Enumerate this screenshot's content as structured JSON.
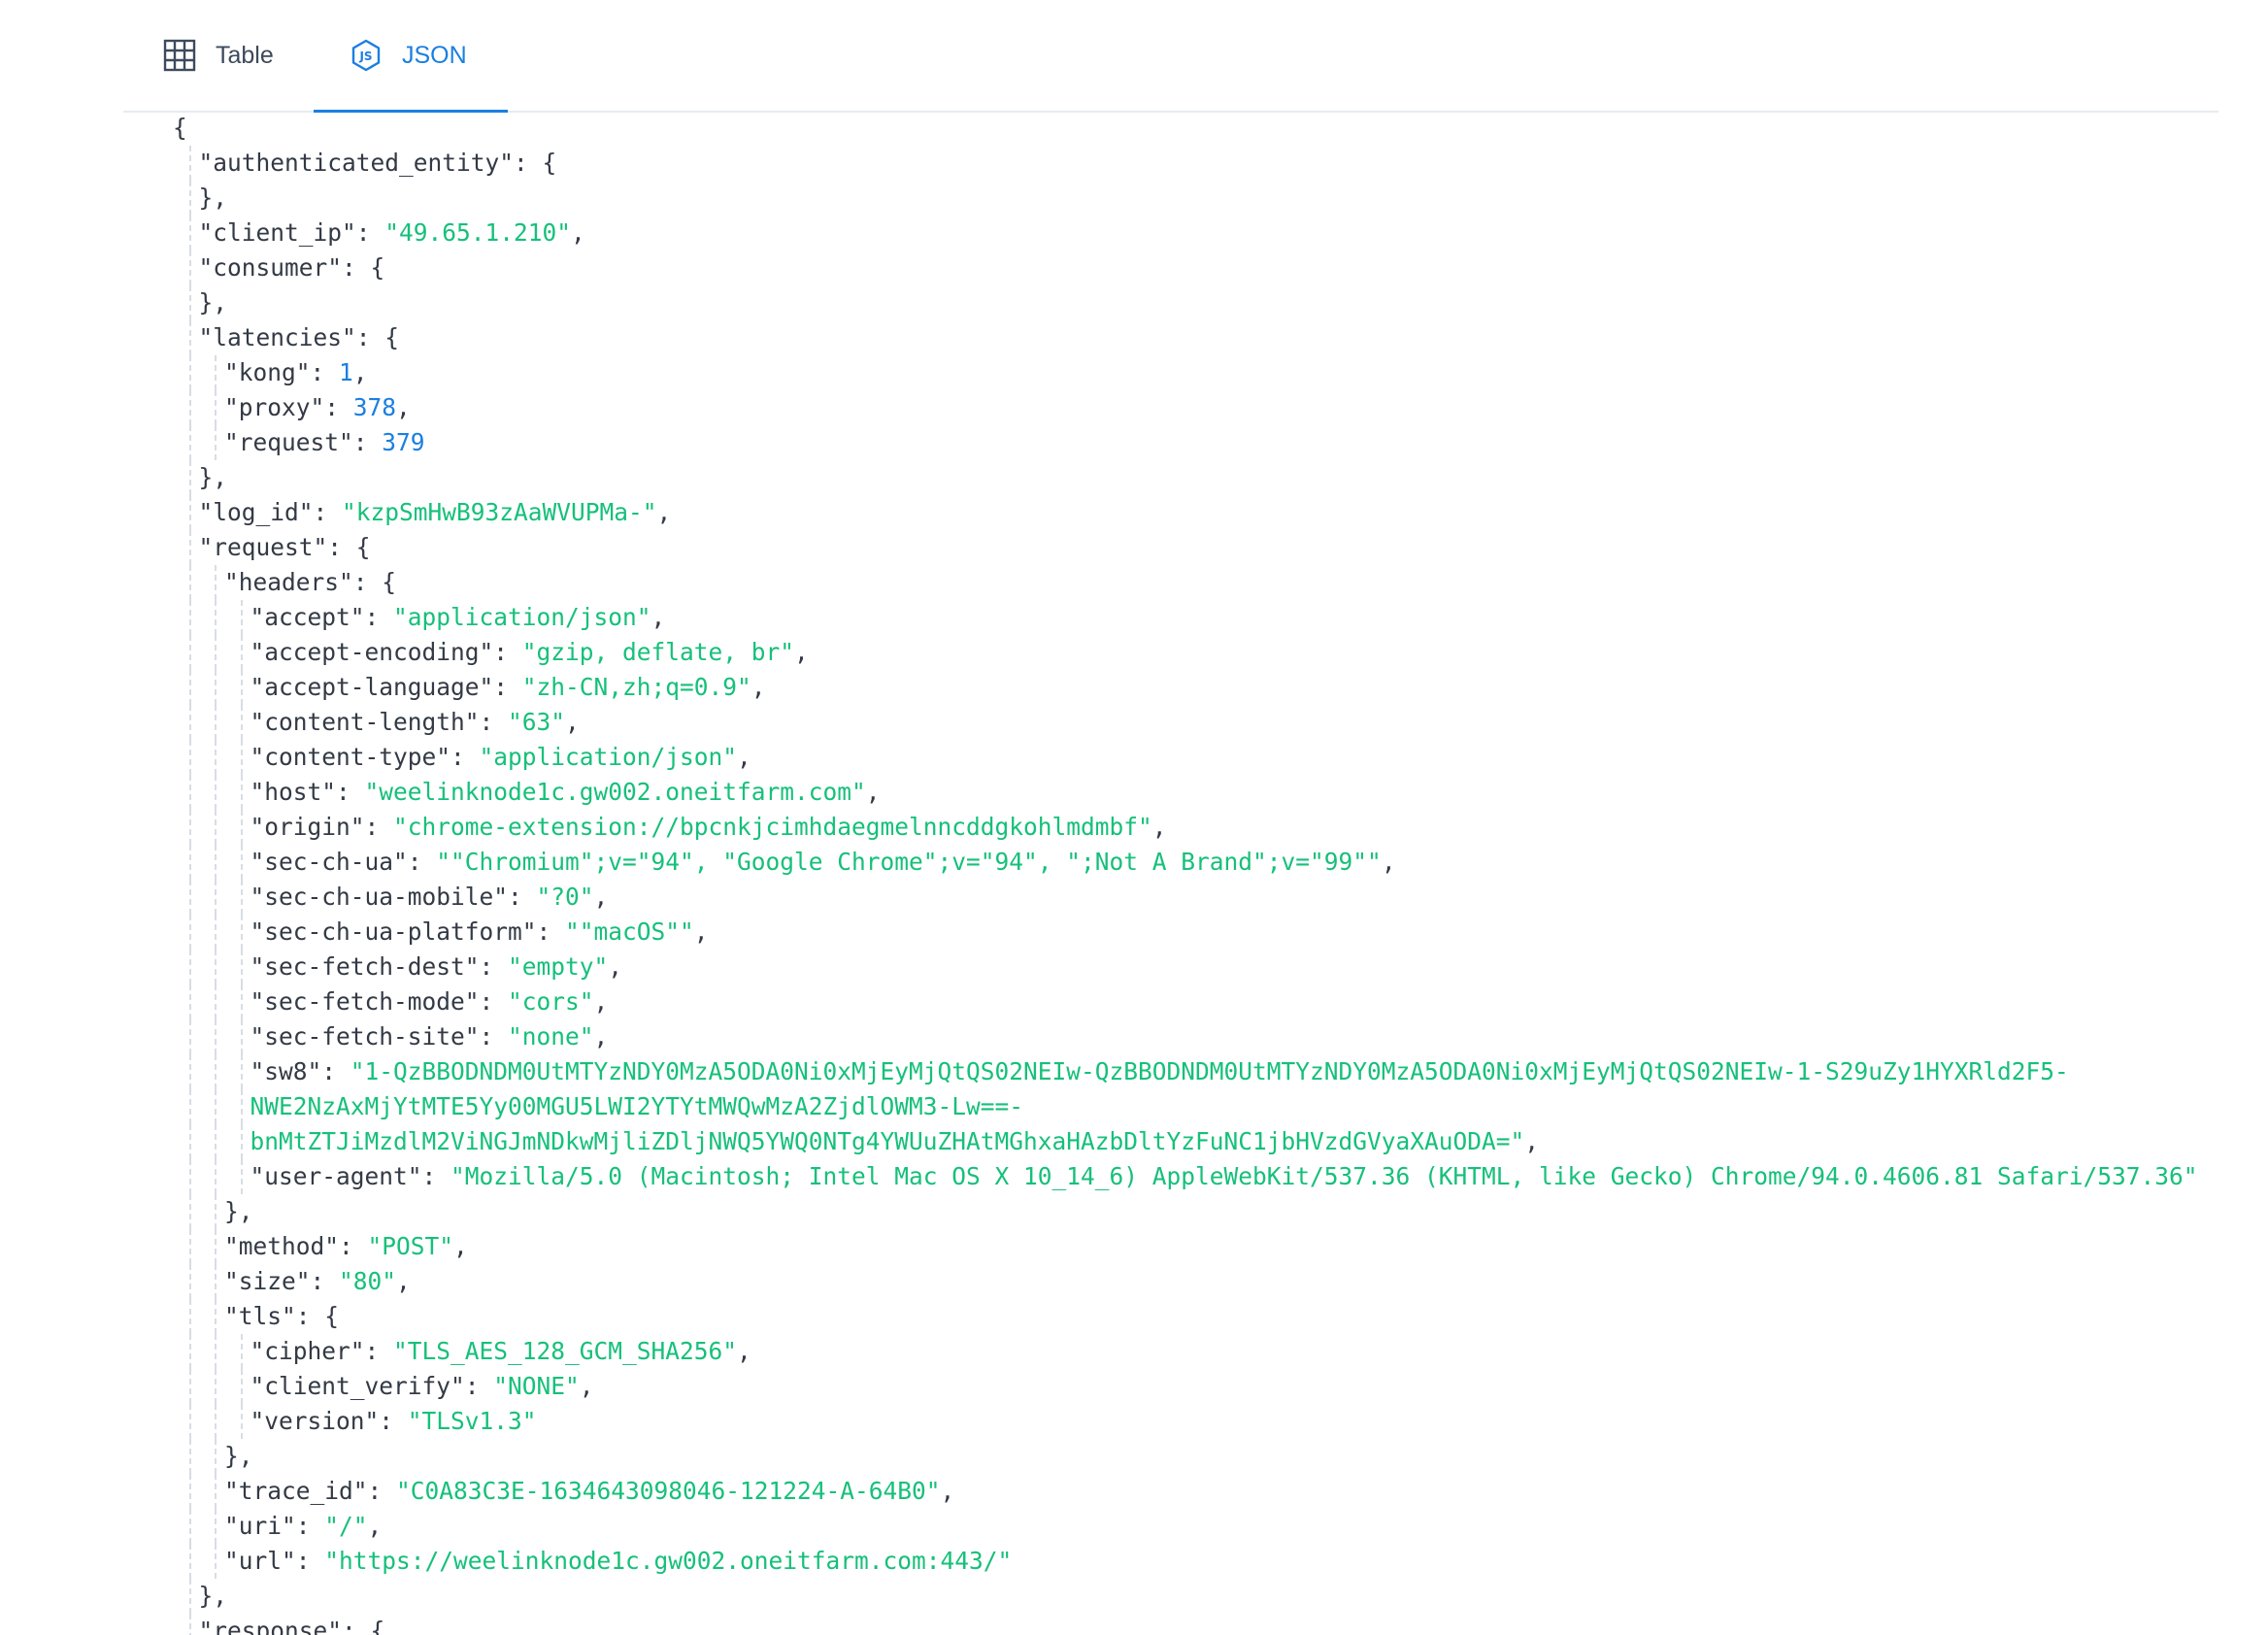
{
  "tabs": [
    {
      "label": "Table",
      "icon": "grid-table-icon",
      "active": false
    },
    {
      "label": "JSON",
      "icon": "js-hexagon-icon",
      "active": true
    }
  ],
  "colors": {
    "accent": "#1b7fe0",
    "string": "#16c07a",
    "number": "#1b7fe0",
    "key": "#333a45",
    "guide": "#d8dde3"
  },
  "json_lines": [
    {
      "depth": 0,
      "segments": [
        {
          "t": "p",
          "v": "{"
        }
      ]
    },
    {
      "depth": 1,
      "segments": [
        {
          "t": "k",
          "v": "\"authenticated_entity\""
        },
        {
          "t": "p",
          "v": ": {"
        }
      ]
    },
    {
      "depth": 1,
      "segments": [
        {
          "t": "p",
          "v": "},"
        }
      ]
    },
    {
      "depth": 1,
      "segments": [
        {
          "t": "k",
          "v": "\"client_ip\""
        },
        {
          "t": "p",
          "v": ": "
        },
        {
          "t": "s",
          "v": "\"49.65.1.210\""
        },
        {
          "t": "p",
          "v": ","
        }
      ]
    },
    {
      "depth": 1,
      "segments": [
        {
          "t": "k",
          "v": "\"consumer\""
        },
        {
          "t": "p",
          "v": ": {"
        }
      ]
    },
    {
      "depth": 1,
      "segments": [
        {
          "t": "p",
          "v": "},"
        }
      ]
    },
    {
      "depth": 1,
      "segments": [
        {
          "t": "k",
          "v": "\"latencies\""
        },
        {
          "t": "p",
          "v": ": {"
        }
      ]
    },
    {
      "depth": 2,
      "segments": [
        {
          "t": "k",
          "v": "\"kong\""
        },
        {
          "t": "p",
          "v": ": "
        },
        {
          "t": "n",
          "v": "1"
        },
        {
          "t": "p",
          "v": ","
        }
      ]
    },
    {
      "depth": 2,
      "segments": [
        {
          "t": "k",
          "v": "\"proxy\""
        },
        {
          "t": "p",
          "v": ": "
        },
        {
          "t": "n",
          "v": "378"
        },
        {
          "t": "p",
          "v": ","
        }
      ]
    },
    {
      "depth": 2,
      "segments": [
        {
          "t": "k",
          "v": "\"request\""
        },
        {
          "t": "p",
          "v": ": "
        },
        {
          "t": "n",
          "v": "379"
        }
      ]
    },
    {
      "depth": 1,
      "segments": [
        {
          "t": "p",
          "v": "},"
        }
      ]
    },
    {
      "depth": 1,
      "segments": [
        {
          "t": "k",
          "v": "\"log_id\""
        },
        {
          "t": "p",
          "v": ": "
        },
        {
          "t": "s",
          "v": "\"kzpSmHwB93zAaWVUPMa-\""
        },
        {
          "t": "p",
          "v": ","
        }
      ]
    },
    {
      "depth": 1,
      "segments": [
        {
          "t": "k",
          "v": "\"request\""
        },
        {
          "t": "p",
          "v": ": {"
        }
      ]
    },
    {
      "depth": 2,
      "segments": [
        {
          "t": "k",
          "v": "\"headers\""
        },
        {
          "t": "p",
          "v": ": {"
        }
      ]
    },
    {
      "depth": 3,
      "segments": [
        {
          "t": "k",
          "v": "\"accept\""
        },
        {
          "t": "p",
          "v": ": "
        },
        {
          "t": "s",
          "v": "\"application/json\""
        },
        {
          "t": "p",
          "v": ","
        }
      ]
    },
    {
      "depth": 3,
      "segments": [
        {
          "t": "k",
          "v": "\"accept-encoding\""
        },
        {
          "t": "p",
          "v": ": "
        },
        {
          "t": "s",
          "v": "\"gzip, deflate, br\""
        },
        {
          "t": "p",
          "v": ","
        }
      ]
    },
    {
      "depth": 3,
      "segments": [
        {
          "t": "k",
          "v": "\"accept-language\""
        },
        {
          "t": "p",
          "v": ": "
        },
        {
          "t": "s",
          "v": "\"zh-CN,zh;q=0.9\""
        },
        {
          "t": "p",
          "v": ","
        }
      ]
    },
    {
      "depth": 3,
      "segments": [
        {
          "t": "k",
          "v": "\"content-length\""
        },
        {
          "t": "p",
          "v": ": "
        },
        {
          "t": "s",
          "v": "\"63\""
        },
        {
          "t": "p",
          "v": ","
        }
      ]
    },
    {
      "depth": 3,
      "segments": [
        {
          "t": "k",
          "v": "\"content-type\""
        },
        {
          "t": "p",
          "v": ": "
        },
        {
          "t": "s",
          "v": "\"application/json\""
        },
        {
          "t": "p",
          "v": ","
        }
      ]
    },
    {
      "depth": 3,
      "segments": [
        {
          "t": "k",
          "v": "\"host\""
        },
        {
          "t": "p",
          "v": ": "
        },
        {
          "t": "s",
          "v": "\"weelinknode1c.gw002.oneitfarm.com\""
        },
        {
          "t": "p",
          "v": ","
        }
      ]
    },
    {
      "depth": 3,
      "segments": [
        {
          "t": "k",
          "v": "\"origin\""
        },
        {
          "t": "p",
          "v": ": "
        },
        {
          "t": "s",
          "v": "\"chrome-extension://bpcnkjcimhdaegmelnncddgkohlmdmbf\""
        },
        {
          "t": "p",
          "v": ","
        }
      ]
    },
    {
      "depth": 3,
      "segments": [
        {
          "t": "k",
          "v": "\"sec-ch-ua\""
        },
        {
          "t": "p",
          "v": ": "
        },
        {
          "t": "s",
          "v": "\"\"Chromium\";v=\"94\", \"Google Chrome\";v=\"94\", \";Not A Brand\";v=\"99\"\""
        },
        {
          "t": "p",
          "v": ","
        }
      ]
    },
    {
      "depth": 3,
      "segments": [
        {
          "t": "k",
          "v": "\"sec-ch-ua-mobile\""
        },
        {
          "t": "p",
          "v": ": "
        },
        {
          "t": "s",
          "v": "\"?0\""
        },
        {
          "t": "p",
          "v": ","
        }
      ]
    },
    {
      "depth": 3,
      "segments": [
        {
          "t": "k",
          "v": "\"sec-ch-ua-platform\""
        },
        {
          "t": "p",
          "v": ": "
        },
        {
          "t": "s",
          "v": "\"\"macOS\"\""
        },
        {
          "t": "p",
          "v": ","
        }
      ]
    },
    {
      "depth": 3,
      "segments": [
        {
          "t": "k",
          "v": "\"sec-fetch-dest\""
        },
        {
          "t": "p",
          "v": ": "
        },
        {
          "t": "s",
          "v": "\"empty\""
        },
        {
          "t": "p",
          "v": ","
        }
      ]
    },
    {
      "depth": 3,
      "segments": [
        {
          "t": "k",
          "v": "\"sec-fetch-mode\""
        },
        {
          "t": "p",
          "v": ": "
        },
        {
          "t": "s",
          "v": "\"cors\""
        },
        {
          "t": "p",
          "v": ","
        }
      ]
    },
    {
      "depth": 3,
      "segments": [
        {
          "t": "k",
          "v": "\"sec-fetch-site\""
        },
        {
          "t": "p",
          "v": ": "
        },
        {
          "t": "s",
          "v": "\"none\""
        },
        {
          "t": "p",
          "v": ","
        }
      ]
    },
    {
      "depth": 3,
      "segments": [
        {
          "t": "k",
          "v": "\"sw8\""
        },
        {
          "t": "p",
          "v": ": "
        },
        {
          "t": "s",
          "v": "\"1-QzBBODNDM0UtMTYzNDY0MzA5ODA0Ni0xMjEyMjQtQS02NEIw-QzBBODNDM0UtMTYzNDY0MzA5ODA0Ni0xMjEyMjQtQS02NEIw-1-S29uZy1HYXRld2F5-"
        }
      ]
    },
    {
      "depth": 3,
      "segments": [
        {
          "t": "s",
          "v": "NWE2NzAxMjYtMTE5Yy00MGU5LWI2YTYtMWQwMzA2ZjdlOWM3-Lw==-"
        }
      ]
    },
    {
      "depth": 3,
      "segments": [
        {
          "t": "s",
          "v": "bnMtZTJiMzdlM2ViNGJmNDkwMjliZDljNWQ5YWQ0NTg4YWUuZHAtMGhxaHAzbDltYzFuNC1jbHVzdGVyaXAuODA=\""
        },
        {
          "t": "p",
          "v": ","
        }
      ]
    },
    {
      "depth": 3,
      "segments": [
        {
          "t": "k",
          "v": "\"user-agent\""
        },
        {
          "t": "p",
          "v": ": "
        },
        {
          "t": "s",
          "v": "\"Mozilla/5.0 (Macintosh; Intel Mac OS X 10_14_6) AppleWebKit/537.36 (KHTML, like Gecko) Chrome/94.0.4606.81 Safari/537.36\""
        }
      ]
    },
    {
      "depth": 2,
      "segments": [
        {
          "t": "p",
          "v": "},"
        }
      ]
    },
    {
      "depth": 2,
      "segments": [
        {
          "t": "k",
          "v": "\"method\""
        },
        {
          "t": "p",
          "v": ": "
        },
        {
          "t": "s",
          "v": "\"POST\""
        },
        {
          "t": "p",
          "v": ","
        }
      ]
    },
    {
      "depth": 2,
      "segments": [
        {
          "t": "k",
          "v": "\"size\""
        },
        {
          "t": "p",
          "v": ": "
        },
        {
          "t": "s",
          "v": "\"80\""
        },
        {
          "t": "p",
          "v": ","
        }
      ]
    },
    {
      "depth": 2,
      "segments": [
        {
          "t": "k",
          "v": "\"tls\""
        },
        {
          "t": "p",
          "v": ": {"
        }
      ]
    },
    {
      "depth": 3,
      "segments": [
        {
          "t": "k",
          "v": "\"cipher\""
        },
        {
          "t": "p",
          "v": ": "
        },
        {
          "t": "s",
          "v": "\"TLS_AES_128_GCM_SHA256\""
        },
        {
          "t": "p",
          "v": ","
        }
      ]
    },
    {
      "depth": 3,
      "segments": [
        {
          "t": "k",
          "v": "\"client_verify\""
        },
        {
          "t": "p",
          "v": ": "
        },
        {
          "t": "s",
          "v": "\"NONE\""
        },
        {
          "t": "p",
          "v": ","
        }
      ]
    },
    {
      "depth": 3,
      "segments": [
        {
          "t": "k",
          "v": "\"version\""
        },
        {
          "t": "p",
          "v": ": "
        },
        {
          "t": "s",
          "v": "\"TLSv1.3\""
        }
      ]
    },
    {
      "depth": 2,
      "segments": [
        {
          "t": "p",
          "v": "},"
        }
      ]
    },
    {
      "depth": 2,
      "segments": [
        {
          "t": "k",
          "v": "\"trace_id\""
        },
        {
          "t": "p",
          "v": ": "
        },
        {
          "t": "s",
          "v": "\"C0A83C3E-1634643098046-121224-A-64B0\""
        },
        {
          "t": "p",
          "v": ","
        }
      ]
    },
    {
      "depth": 2,
      "segments": [
        {
          "t": "k",
          "v": "\"uri\""
        },
        {
          "t": "p",
          "v": ": "
        },
        {
          "t": "s",
          "v": "\"/\""
        },
        {
          "t": "p",
          "v": ","
        }
      ]
    },
    {
      "depth": 2,
      "segments": [
        {
          "t": "k",
          "v": "\"url\""
        },
        {
          "t": "p",
          "v": ": "
        },
        {
          "t": "s",
          "v": "\"https://weelinknode1c.gw002.oneitfarm.com:443/\""
        }
      ]
    },
    {
      "depth": 1,
      "segments": [
        {
          "t": "p",
          "v": "},"
        }
      ]
    },
    {
      "depth": 1,
      "segments": [
        {
          "t": "k",
          "v": "\"response\""
        },
        {
          "t": "p",
          "v": ": {"
        }
      ]
    }
  ]
}
